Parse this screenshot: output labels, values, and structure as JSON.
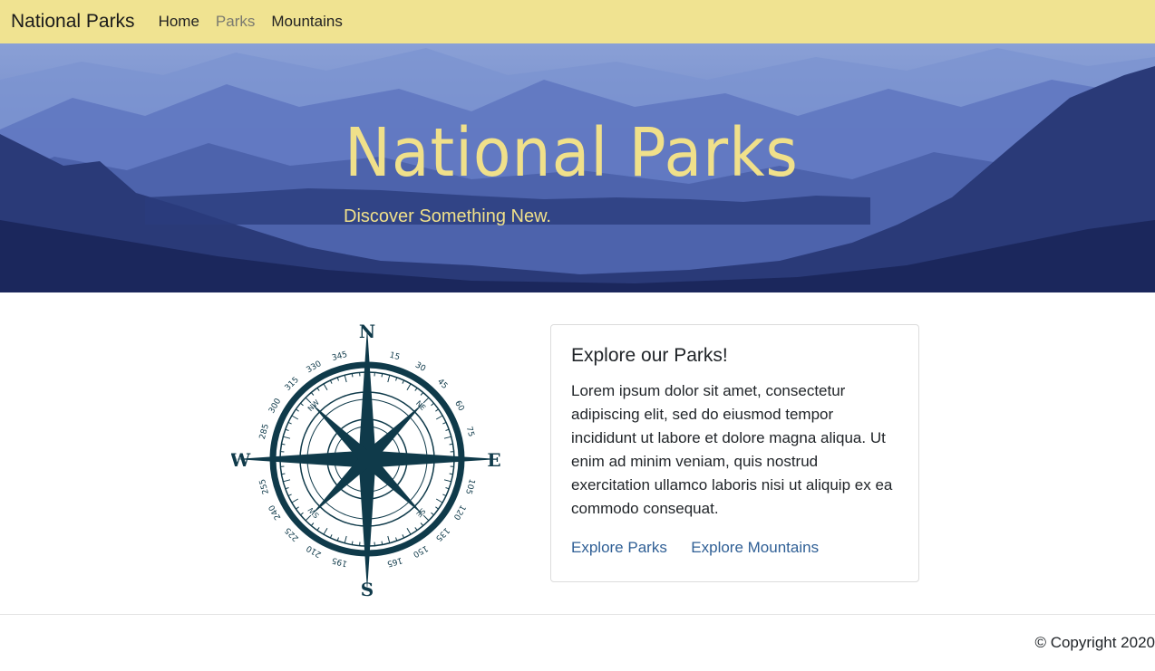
{
  "navbar": {
    "brand": "National Parks",
    "links": [
      {
        "label": "Home",
        "active": false
      },
      {
        "label": "Parks",
        "active": true
      },
      {
        "label": "Mountains",
        "active": false
      }
    ],
    "background": "#f0e391"
  },
  "hero": {
    "title": "National Parks",
    "subtitle": "Discover Something New.",
    "text_color": "#f0e08a"
  },
  "compass": {
    "icon": "compass-rose-image",
    "cardinals": [
      "N",
      "E",
      "S",
      "W"
    ],
    "degree_labels": [
      "15",
      "30",
      "45",
      "60",
      "75",
      "105",
      "120",
      "135",
      "150",
      "165",
      "195",
      "210",
      "225",
      "240",
      "255",
      "285",
      "300",
      "315",
      "330",
      "345"
    ],
    "intercardinals": [
      "NE",
      "SE",
      "SW",
      "NW"
    ]
  },
  "card": {
    "title": "Explore our Parks!",
    "text": "Lorem ipsum dolor sit amet, consectetur adipiscing elit, sed do eiusmod tempor incididunt ut labore et dolore magna aliqua. Ut enim ad minim veniam, quis nostrud exercitation ullamco laboris nisi ut aliquip ex ea commodo consequat.",
    "links": [
      "Explore Parks",
      "Explore Mountains"
    ],
    "link_color": "#2f5f95"
  },
  "footer": {
    "copyright": "© Copyright 2020"
  }
}
